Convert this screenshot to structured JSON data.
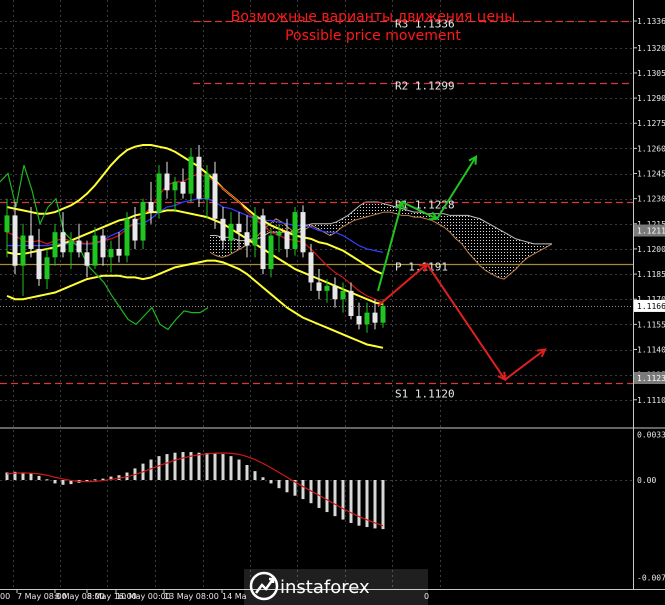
{
  "chart_data": [
    {
      "type": "line",
      "symbol": "EURUSD",
      "title_ru": "Возможные варианты движения цены",
      "title_en": "Possible price movement",
      "ylim": [
        1.1095,
        1.1345
      ],
      "y_ticks": [
        "1.1336",
        "1.1320",
        "1.1305",
        "1.1290",
        "1.1275",
        "1.1260",
        "1.1245",
        "1.1230",
        "1.1215",
        "1.1200",
        "1.1185",
        "1.1170",
        "1.1155",
        "1.1140",
        "1.1125",
        "1.1110"
      ],
      "x_ticks": [
        "7 May 08:00",
        "8 May 08:00",
        "8 May 16:00",
        "10 May 00:00",
        "13 May 08:00",
        "14 Ma"
      ],
      "x_ticks_partial": [
        "00",
        "0"
      ],
      "current_price": "1.1166",
      "price_tags": [
        "1.1211",
        "1.1123"
      ],
      "levels": [
        {
          "name": "R3",
          "value": "1.1336",
          "color": "#d83a3a",
          "style": "dashed"
        },
        {
          "name": "R2",
          "value": "1.1299",
          "color": "#d83a3a",
          "style": "dashed"
        },
        {
          "name": "R1",
          "value": "1.1228",
          "color": "#d83a3a",
          "style": "dashed"
        },
        {
          "name": "P",
          "value": "1.1191",
          "color": "#a58a3a",
          "style": "solid"
        },
        {
          "name": "S1",
          "value": "1.1120",
          "color": "#d83a3a",
          "style": "dashed"
        }
      ],
      "candles": [
        [
          1.121,
          1.123,
          1.1195,
          1.122
        ],
        [
          1.122,
          1.1228,
          1.1185,
          1.119
        ],
        [
          1.119,
          1.1215,
          1.1172,
          1.1208
        ],
        [
          1.1208,
          1.1225,
          1.1195,
          1.12
        ],
        [
          1.12,
          1.1212,
          1.1178,
          1.1182
        ],
        [
          1.1182,
          1.12,
          1.1176,
          1.1195
        ],
        [
          1.1195,
          1.1215,
          1.119,
          1.121
        ],
        [
          1.121,
          1.1222,
          1.1195,
          1.1198
        ],
        [
          1.1198,
          1.121,
          1.1188,
          1.1205
        ],
        [
          1.1205,
          1.1215,
          1.1195,
          1.1198
        ],
        [
          1.1198,
          1.1205,
          1.1183,
          1.119
        ],
        [
          1.119,
          1.1213,
          1.1188,
          1.1208
        ],
        [
          1.1208,
          1.1212,
          1.119,
          1.1195
        ],
        [
          1.1195,
          1.1205,
          1.1186,
          1.12
        ],
        [
          1.12,
          1.121,
          1.1192,
          1.1196
        ],
        [
          1.1196,
          1.1222,
          1.1192,
          1.1218
        ],
        [
          1.1218,
          1.1225,
          1.12,
          1.1205
        ],
        [
          1.1205,
          1.123,
          1.12,
          1.1228
        ],
        [
          1.1228,
          1.124,
          1.1215,
          1.1222
        ],
        [
          1.1222,
          1.125,
          1.1218,
          1.1245
        ],
        [
          1.1245,
          1.1252,
          1.123,
          1.1235
        ],
        [
          1.1235,
          1.1243,
          1.1222,
          1.124
        ],
        [
          1.124,
          1.1248,
          1.123,
          1.1233
        ],
        [
          1.1233,
          1.126,
          1.1228,
          1.1255
        ],
        [
          1.1255,
          1.1262,
          1.1225,
          1.123
        ],
        [
          1.123,
          1.125,
          1.1218,
          1.1245
        ],
        [
          1.1245,
          1.1252,
          1.1212,
          1.1218
        ],
        [
          1.1218,
          1.1225,
          1.12,
          1.1205
        ],
        [
          1.1205,
          1.1222,
          1.1198,
          1.1215
        ],
        [
          1.1215,
          1.1222,
          1.12,
          1.121
        ],
        [
          1.121,
          1.122,
          1.1195,
          1.1202
        ],
        [
          1.1202,
          1.1225,
          1.1195,
          1.122
        ],
        [
          1.122,
          1.1224,
          1.1185,
          1.1188
        ],
        [
          1.1188,
          1.1212,
          1.1183,
          1.1208
        ],
        [
          1.1208,
          1.1215,
          1.1198,
          1.121
        ],
        [
          1.121,
          1.1218,
          1.1195,
          1.12
        ],
        [
          1.12,
          1.1225,
          1.1196,
          1.1222
        ],
        [
          1.1222,
          1.1226,
          1.1195,
          1.1198
        ],
        [
          1.1198,
          1.1203,
          1.1175,
          1.118
        ],
        [
          1.118,
          1.1188,
          1.117,
          1.1175
        ],
        [
          1.1175,
          1.1182,
          1.1168,
          1.1178
        ],
        [
          1.1178,
          1.1183,
          1.1165,
          1.117
        ],
        [
          1.117,
          1.118,
          1.1162,
          1.1175
        ],
        [
          1.1175,
          1.118,
          1.1158,
          1.116
        ],
        [
          1.116,
          1.1168,
          1.1152,
          1.1155
        ],
        [
          1.1155,
          1.1168,
          1.115,
          1.1162
        ],
        [
          1.1162,
          1.117,
          1.1152,
          1.1156
        ],
        [
          1.1156,
          1.117,
          1.1153,
          1.1166
        ]
      ],
      "bollinger": {
        "upper": [
          1.1225,
          1.1224,
          1.1223,
          1.1222,
          1.1221,
          1.1221,
          1.1222,
          1.1224,
          1.1226,
          1.1229,
          1.1233,
          1.1238,
          1.1244,
          1.125,
          1.1255,
          1.1259,
          1.1261,
          1.1262,
          1.1262,
          1.1261,
          1.126,
          1.1258,
          1.1255,
          1.1252,
          1.1249,
          1.1245,
          1.1241,
          1.1236,
          1.1232,
          1.1228,
          1.1224,
          1.122,
          1.1217,
          1.1214,
          1.1212,
          1.121,
          1.1208,
          1.1207,
          1.1206,
          1.1204,
          1.1203,
          1.1201,
          1.1199,
          1.1196,
          1.1193,
          1.119,
          1.1187,
          1.1185
        ],
        "middle": [
          1.1198,
          1.1197,
          1.1197,
          1.1198,
          1.1199,
          1.12,
          1.1201,
          1.1203,
          1.1205,
          1.1207,
          1.1209,
          1.1211,
          1.1213,
          1.1215,
          1.1217,
          1.1218,
          1.122,
          1.1221,
          1.1222,
          1.1222,
          1.1223,
          1.1223,
          1.1222,
          1.1221,
          1.122,
          1.1219,
          1.1217,
          1.1215,
          1.1212,
          1.1209,
          1.1206,
          1.1203,
          1.12,
          1.1197,
          1.1194,
          1.1191,
          1.1188,
          1.1186,
          1.1184,
          1.1182,
          1.118,
          1.1178,
          1.1176,
          1.1174,
          1.1172,
          1.117,
          1.1168,
          1.1167
        ],
        "lower": [
          1.1172,
          1.117,
          1.117,
          1.1171,
          1.1172,
          1.1173,
          1.1174,
          1.1176,
          1.1178,
          1.118,
          1.1182,
          1.1183,
          1.1184,
          1.1184,
          1.1184,
          1.1183,
          1.1183,
          1.1182,
          1.1183,
          1.1185,
          1.1187,
          1.1189,
          1.119,
          1.1191,
          1.1192,
          1.1193,
          1.1193,
          1.1192,
          1.119,
          1.1188,
          1.1185,
          1.1181,
          1.1177,
          1.1173,
          1.1169,
          1.1165,
          1.1162,
          1.1159,
          1.1157,
          1.1155,
          1.1153,
          1.1151,
          1.1149,
          1.1147,
          1.1145,
          1.1143,
          1.1142,
          1.1141
        ]
      },
      "ichimoku": {
        "tenkan": [
          1.121,
          1.1208,
          1.1205,
          1.1204,
          1.1205,
          1.1203,
          1.1205,
          1.1206,
          1.1205,
          1.1204,
          1.1203,
          1.1204,
          1.1205,
          1.1206,
          1.1208,
          1.1212,
          1.1216,
          1.122,
          1.1225,
          1.1232,
          1.1238,
          1.124,
          1.124,
          1.1243,
          1.1245,
          1.1243,
          1.124,
          1.1236,
          1.1232,
          1.1228,
          1.1222,
          1.1218,
          1.1214,
          1.121,
          1.1208,
          1.1206,
          1.1205,
          1.1204,
          1.12,
          1.1195,
          1.119,
          1.1186,
          1.1183,
          1.1179,
          1.1175,
          1.1172,
          1.117,
          1.1168
        ],
        "kijun": [
          1.1202,
          1.1202,
          1.1202,
          1.1202,
          1.1202,
          1.1202,
          1.1203,
          1.1203,
          1.1203,
          1.1203,
          1.1203,
          1.1203,
          1.1205,
          1.1208,
          1.121,
          1.1213,
          1.1215,
          1.1215,
          1.1218,
          1.1222,
          1.1225,
          1.1226,
          1.1228,
          1.1229,
          1.123,
          1.123,
          1.1228,
          1.1225,
          1.1224,
          1.1222,
          1.122,
          1.1218,
          1.1217,
          1.1217,
          1.1216,
          1.1215,
          1.1214,
          1.1214,
          1.1213,
          1.1211,
          1.121,
          1.121,
          1.1208,
          1.1205,
          1.1202,
          1.12,
          1.1199,
          1.1198
        ],
        "chikou": [
          1.124,
          1.1245,
          1.1225,
          1.125,
          1.1235,
          1.1215,
          1.1225,
          1.123,
          1.121,
          1.1205,
          1.12,
          1.119,
          1.1185,
          1.118,
          1.1172,
          1.1165,
          1.1158,
          1.1155,
          1.116,
          1.1165,
          1.1155,
          1.1152,
          1.1158,
          1.1163,
          1.1162,
          1.1162,
          1.1165
        ],
        "cloud_a": [
          1.1198,
          1.1196,
          1.1195,
          1.1196,
          1.1198,
          1.12,
          1.1202,
          1.1205,
          1.1208,
          1.1212,
          1.1215,
          1.1218,
          1.1216,
          1.1213,
          1.121,
          1.121,
          1.1212,
          1.1214,
          1.1212,
          1.121,
          1.1208,
          1.121,
          1.1213,
          1.1215,
          1.1217,
          1.1218,
          1.1219,
          1.122,
          1.1221,
          1.1222,
          1.1222,
          1.1221,
          1.122,
          1.122,
          1.1219,
          1.1219,
          1.1218,
          1.1217,
          1.1215,
          1.1213,
          1.121,
          1.1206,
          1.1203,
          1.1198,
          1.1194,
          1.119,
          1.1187,
          1.1185,
          1.1183,
          1.1182,
          1.1185,
          1.1188,
          1.1192,
          1.1195,
          1.1197,
          1.1199,
          1.1201,
          1.1203
        ],
        "cloud_b": [
          1.1208,
          1.1208,
          1.1207,
          1.1207,
          1.1206,
          1.1205,
          1.1205,
          1.1206,
          1.1206,
          1.1208,
          1.121,
          1.121,
          1.121,
          1.121,
          1.121,
          1.1212,
          1.1214,
          1.1215,
          1.1215,
          1.1215,
          1.1215,
          1.1216,
          1.1218,
          1.122,
          1.1223,
          1.1226,
          1.1228,
          1.1228,
          1.1228,
          1.1227,
          1.1226,
          1.1225,
          1.1224,
          1.1223,
          1.1222,
          1.1222,
          1.1221,
          1.1221,
          1.1221,
          1.1221,
          1.122,
          1.122,
          1.122,
          1.122,
          1.1219,
          1.1218,
          1.1216,
          1.1214,
          1.1212,
          1.121,
          1.1208,
          1.1206,
          1.1205,
          1.1204,
          1.1203,
          1.1203,
          1.1203,
          1.1203
        ]
      },
      "forecast_paths": [
        {
          "direction": "up",
          "color": "#21c521",
          "points": [
            [
              1.1175,
              1.1228
            ],
            [
              1.1228,
              1.1218
            ],
            [
              1.1218,
              1.1255
            ]
          ]
        },
        {
          "direction": "down",
          "color": "#e02020",
          "points": [
            [
              1.1166,
              1.1191
            ],
            [
              1.1191,
              1.1122
            ],
            [
              1.1122,
              1.114
            ]
          ]
        }
      ]
    },
    {
      "type": "bar",
      "indicator": "MACD",
      "y_ticks": [
        "0.00332",
        "0.00",
        "-0.00714"
      ],
      "ylim": [
        -0.00714,
        0.00332
      ],
      "histogram": [
        0.00055,
        0.0006,
        0.00055,
        0.00048,
        0.0003,
        5e-05,
        -0.00025,
        -0.00035,
        -0.0003,
        -0.0002,
        -8e-05,
        5e-05,
        0.0001,
        0.00025,
        0.00035,
        0.00055,
        0.00085,
        0.0012,
        0.0015,
        0.00175,
        0.0019,
        0.002,
        0.00205,
        0.00205,
        0.002,
        0.00198,
        0.00195,
        0.0019,
        0.00175,
        0.0015,
        0.0011,
        0.00065,
        0.0002,
        -0.00025,
        -0.0006,
        -0.0009,
        -0.00115,
        -0.0014,
        -0.0017,
        -0.00205,
        -0.00235,
        -0.00265,
        -0.0029,
        -0.00315,
        -0.00335,
        -0.00345,
        -0.00355,
        -0.0036
      ],
      "signal": [
        0.00045,
        0.0005,
        0.00052,
        0.0005,
        0.00045,
        0.00035,
        0.0002,
        8e-05,
        -3e-05,
        -0.0001,
        -0.00012,
        -0.0001,
        -4e-05,
        4e-05,
        0.00013,
        0.00024,
        0.0004,
        0.0006,
        0.00082,
        0.00104,
        0.00125,
        0.00145,
        0.00162,
        0.00175,
        0.00185,
        0.00192,
        0.00196,
        0.00198,
        0.00196,
        0.00188,
        0.00172,
        0.0015,
        0.00122,
        0.0009,
        0.00055,
        0.0002,
        -0.00015,
        -0.00048,
        -0.0008,
        -0.00112,
        -0.00145,
        -0.00178,
        -0.0021,
        -0.0024,
        -0.00268,
        -0.00292,
        -0.00315,
        -0.00335
      ]
    }
  ],
  "watermark": {
    "brand": "instaforex"
  }
}
